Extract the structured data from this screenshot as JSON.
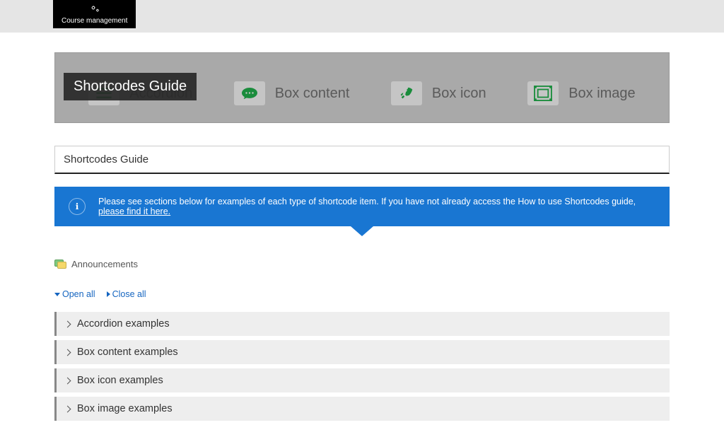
{
  "topbar": {
    "course_management": "Course management"
  },
  "hero": {
    "title": "Shortcodes Guide",
    "items": [
      {
        "icon": "menu-icon",
        "label": "Accordion"
      },
      {
        "icon": "comment-icon",
        "label": "Box content"
      },
      {
        "icon": "rocket-icon",
        "label": "Box icon"
      },
      {
        "icon": "image-icon",
        "label": "Box image"
      }
    ]
  },
  "section_header": "Shortcodes Guide",
  "info_banner": {
    "text_before": "Please see sections below for examples of each type of shortcode item. If you have not already access the How to use Shortcodes guide, ",
    "link_text": "please find it here."
  },
  "announcements_label": "Announcements",
  "controls": {
    "open_all": "Open all",
    "close_all": "Close all"
  },
  "sections": [
    {
      "title": "Accordion examples"
    },
    {
      "title": "Box content examples"
    },
    {
      "title": "Box icon examples"
    },
    {
      "title": "Box image examples"
    }
  ]
}
